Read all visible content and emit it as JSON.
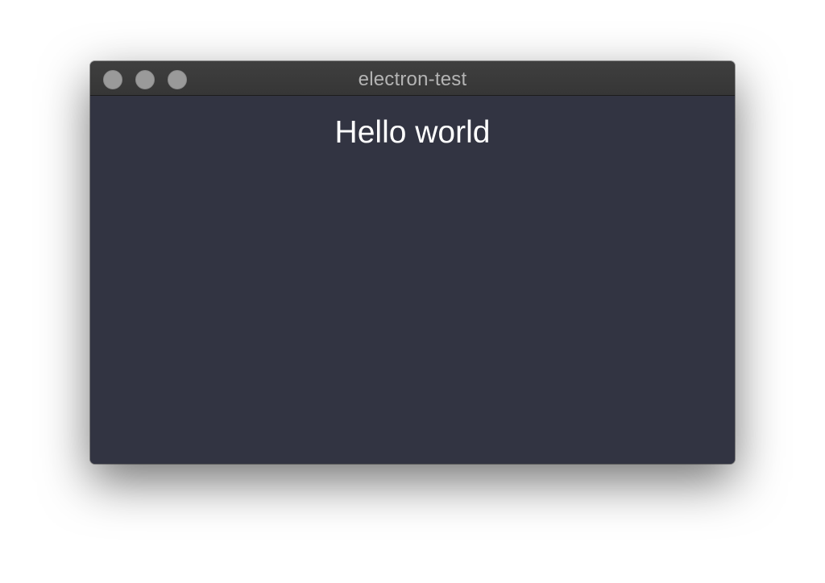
{
  "window": {
    "title": "electron-test",
    "controls": [
      {
        "name": "close",
        "color": "#9a9a9a"
      },
      {
        "name": "minimize",
        "color": "#9a9a9a"
      },
      {
        "name": "zoom",
        "color": "#9a9a9a"
      }
    ]
  },
  "content": {
    "heading": "Hello world"
  },
  "colors": {
    "content_background": "#323442",
    "titlebar_background": "#3a3a3a",
    "title_text": "#b4b4b4",
    "heading_text": "#ffffff",
    "traffic_light_inactive": "#9a9a9a"
  }
}
